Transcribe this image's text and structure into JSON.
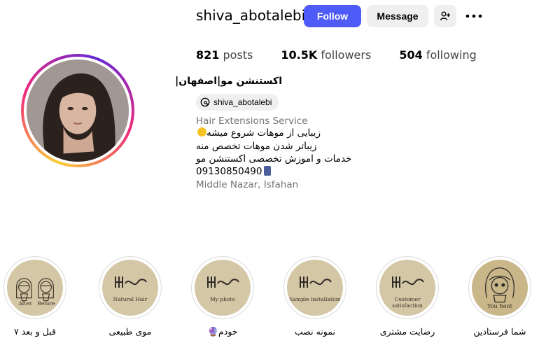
{
  "profile": {
    "username": "shiva_abotalebi",
    "follow_label": "Follow",
    "message_label": "Message",
    "add_user_icon": "person-plus-icon",
    "more_icon": "more-dots-icon",
    "accent_color": "#4f5bf7"
  },
  "stats": {
    "posts_count": "821",
    "posts_label": "posts",
    "followers_count": "10.5K",
    "followers_label": "followers",
    "following_count": "504",
    "following_label": "following"
  },
  "bio": {
    "name": "اکستنشن مو|اصفهان|",
    "threads_handle": "shiva_abotalebi",
    "category": "Hair Extensions Service",
    "line1": "زیبایی از موهات شروع میشه",
    "line2": "زیباتر شدن موهات تخصص منه",
    "line3": "خدمات و اموزش تخصصی اکستنشن مو",
    "phone": "09130850490",
    "location": "Middle Nazar, Isfahan"
  },
  "highlights": [
    {
      "label": "قبل و بعد ۷",
      "caption_left": "After",
      "caption_right": "Before"
    },
    {
      "label": "موی طبیعی",
      "caption": "Natural Hair"
    },
    {
      "label": "خودم🔮",
      "caption": "My photo"
    },
    {
      "label": "نمونه نصب",
      "caption": "Sample installation"
    },
    {
      "label": "رضایت مشتری",
      "caption": "Customer satisfaction"
    },
    {
      "label": "شما فرستادین",
      "caption": "You Sent"
    }
  ]
}
